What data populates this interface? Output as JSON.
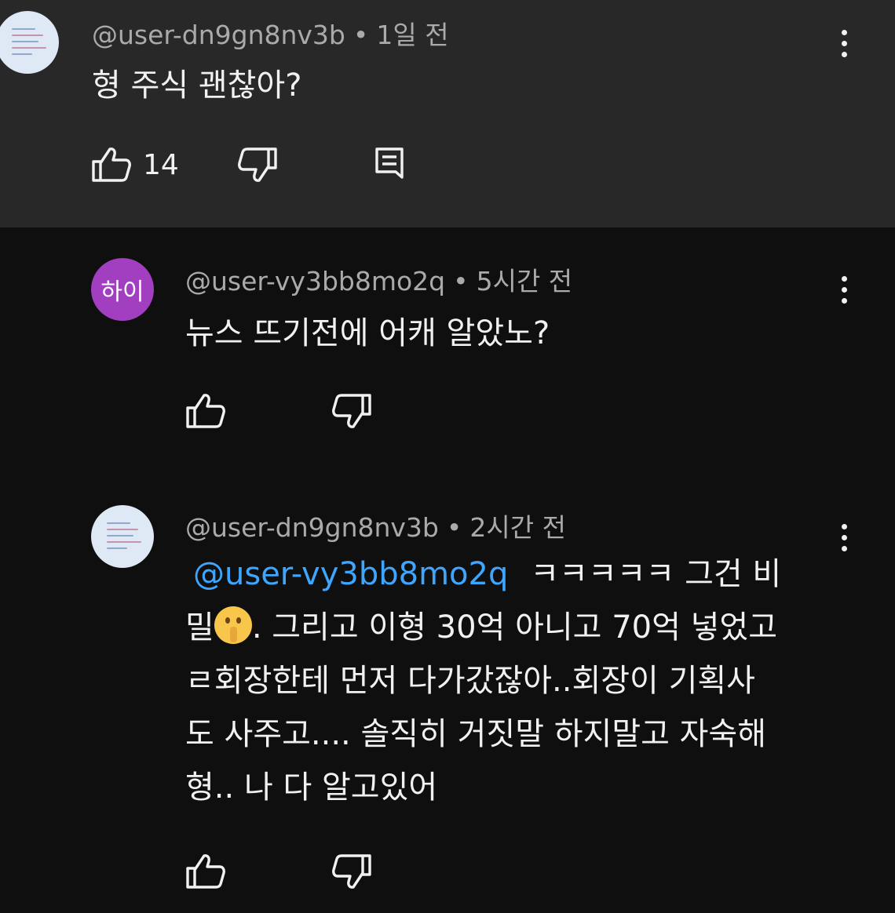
{
  "comments": [
    {
      "handle": "@user-dn9gn8nv3b",
      "time": "1일 전",
      "text": "형 주식 괜찮아?",
      "like_count": "14",
      "avatar_label": ""
    },
    {
      "handle": "@user-vy3bb8mo2q",
      "time": "5시간 전",
      "text": "뉴스 뜨기전에 어캐 알았노?",
      "avatar_label": "하이"
    },
    {
      "handle": "@user-dn9gn8nv3b",
      "time": "2시간 전",
      "mention": "@user-vy3bb8mo2q",
      "lines": [
        "ㅋㅋㅋㅋㅋ 그건 비",
        "밀",
        ". 그리고 이형 30억 아니고 70억 넣었고",
        "ㄹ회장한테 먼저 다가갔잖아..회장이 기획사",
        "도 사주고.... 솔직히 거짓말 하지말고 자숙해",
        "형.. 나 다 알고있어"
      ]
    }
  ],
  "icons": {
    "like": "thumbs-up-icon",
    "dislike": "thumbs-down-icon",
    "reply": "reply-icon",
    "menu": "more-vert-icon",
    "emoji": "shushing-face-emoji"
  },
  "colors": {
    "background": "#0f0f0f",
    "highlight_panel": "#282828",
    "mention": "#3ea6ff",
    "avatar_purple": "#a23fc0"
  }
}
